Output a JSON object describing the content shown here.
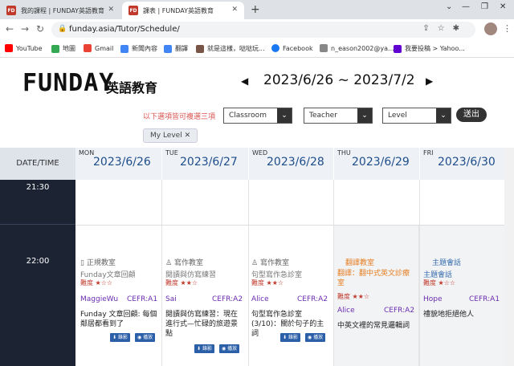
{
  "browser": {
    "tabs": [
      {
        "icon": "FD",
        "label": "我的課程 | FUNDAY英語教育"
      },
      {
        "icon": "FD",
        "label": "課表 | FUNDAY英語教育"
      }
    ],
    "url": "funday.asia/Tutor/Schedule/",
    "bookmarks": [
      {
        "label": "YouTube",
        "color": "#ff0000"
      },
      {
        "label": "地圖",
        "color": "#34a853"
      },
      {
        "label": "Gmail",
        "color": "#ea4335"
      },
      {
        "label": "新聞內容",
        "color": "#4285f4"
      },
      {
        "label": "翻譯",
        "color": "#4285f4"
      },
      {
        "label": "就是這樣，哒哒玩...",
        "color": "#795548"
      },
      {
        "label": "Facebook",
        "color": "#1877f2"
      },
      {
        "label": "n_eason2002@ya...",
        "color": "#888888"
      },
      {
        "label": "我要投稿 > Yahoo...",
        "color": "#6001d2"
      }
    ]
  },
  "header": {
    "logo": "FUNDAY",
    "logo_sub": "英語教育",
    "range": "2023/6/26 ~ 2023/7/2",
    "prev": "◀",
    "next": "▶"
  },
  "filters": {
    "hint": "以下選項皆可複選三項",
    "classroom": "Classroom",
    "teacher": "Teacher",
    "level": "Level",
    "submit": "送出",
    "chip": "My Level"
  },
  "schedule": {
    "date_time_label": "DATE/TIME",
    "days": [
      {
        "dow": "MON",
        "date": "2023/6/26"
      },
      {
        "dow": "TUE",
        "date": "2023/6/27"
      },
      {
        "dow": "WED",
        "date": "2023/6/28"
      },
      {
        "dow": "THU",
        "date": "2023/6/29"
      },
      {
        "dow": "FRI",
        "date": "2023/6/30"
      }
    ],
    "times": [
      "21:30",
      "22:00"
    ],
    "sessions": [
      {
        "classroom": "正規教室",
        "topic": "Funday文章回顧",
        "level": "難度 ★☆☆",
        "tutor": "MaggieWu",
        "cefr": "CEFR:A1",
        "desc": "Funday 文章回顧: 每個鄰居都看到了",
        "btn_rec": "錄影",
        "btn_play": "播放"
      },
      {
        "classroom": "寫作教室",
        "topic": "閱讀與仿寫練習",
        "level": "難度 ★★☆",
        "tutor": "Sai",
        "cefr": "CEFR:A2",
        "desc": "閱讀與仿寫練習：現在進行式—忙碌的旅遊景點",
        "btn_rec": "錄影",
        "btn_play": "播放"
      },
      {
        "classroom": "寫作教室",
        "topic": "句型寫作急診室",
        "level": "難度 ★★☆",
        "tutor": "Alice",
        "cefr": "CEFR:A2",
        "desc": "句型寫作急診室 (3/10)：關於句子的主詞",
        "btn_rec": "錄影",
        "btn_play": "播放"
      },
      {
        "classroom": "翻譯教室",
        "topic": "翻譯：翻中式英文診療室",
        "level": "難度 ★★☆",
        "tutor": "Alice",
        "cefr": "CEFR:A2",
        "desc": "中英文裡的常見邏輯詞",
        "btn_rec": "",
        "btn_play": ""
      },
      {
        "classroom": "主題會話",
        "topic": "主題會話",
        "level": "難度 ★☆☆",
        "tutor": "Hope",
        "cefr": "CEFR:A1",
        "desc": "禮貌地拒絕他人",
        "btn_rec": "",
        "btn_play": ""
      }
    ]
  },
  "colors": {
    "accent": "#1e4d8b",
    "tutor": "#6a2bb0",
    "level": "#c0392b",
    "translate": "#e67e22",
    "topic_blue": "#3a6fb0"
  }
}
